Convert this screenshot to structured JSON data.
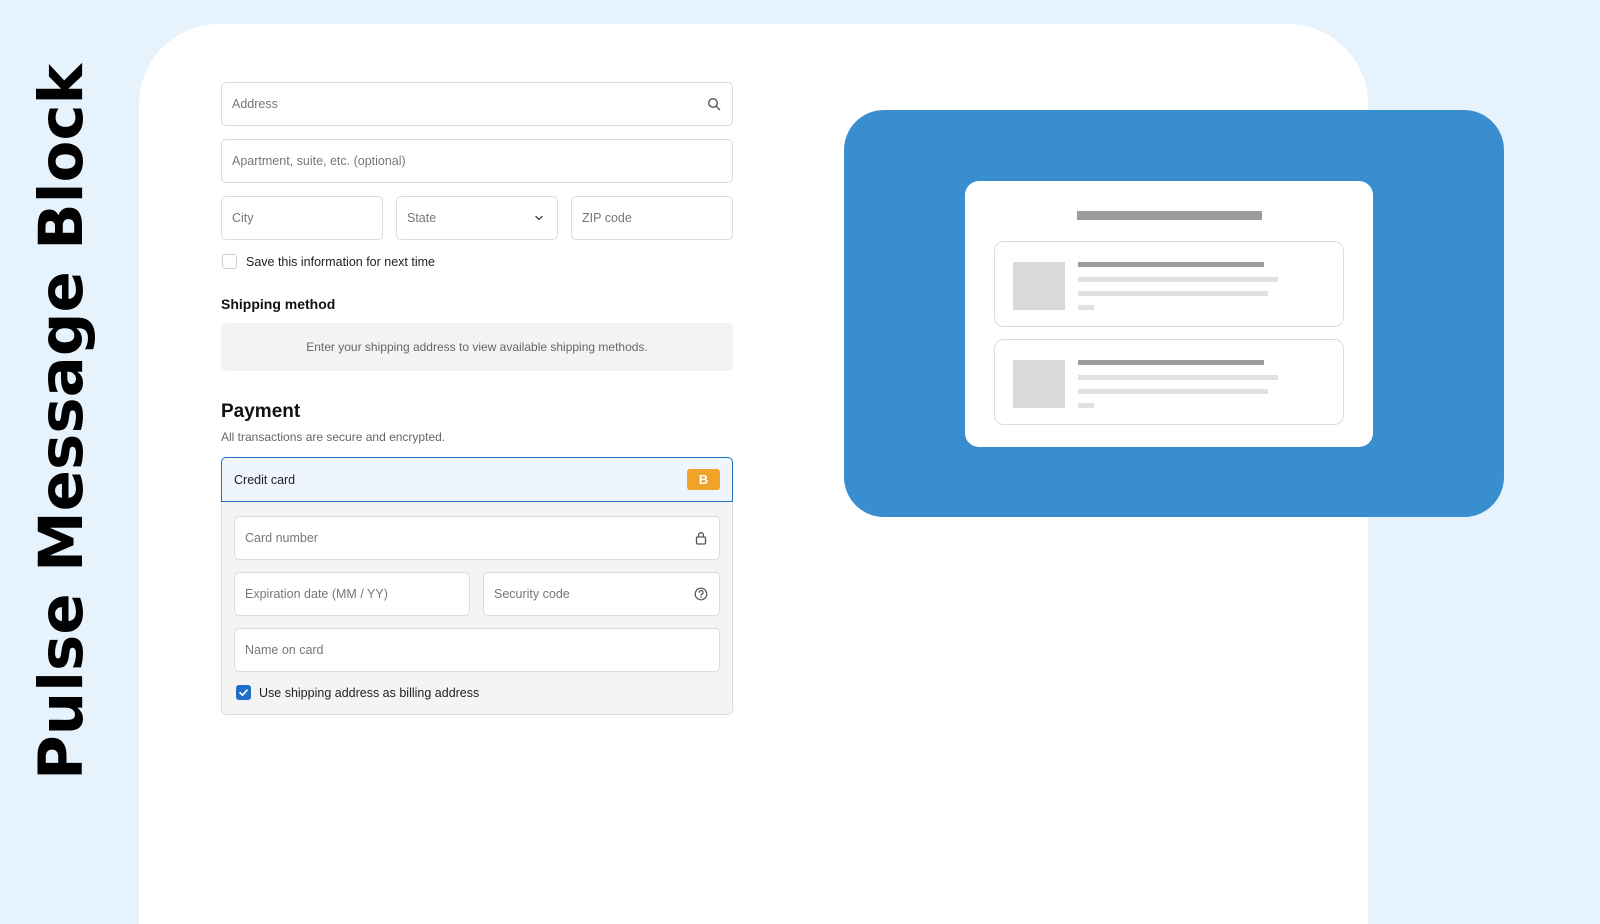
{
  "sidebar": {
    "title": "Pulse Message Block"
  },
  "address": {
    "address_placeholder": "Address",
    "apartment_placeholder": "Apartment, suite, etc. (optional)",
    "city_placeholder": "City",
    "state_label": "State",
    "zip_placeholder": "ZIP code",
    "save_label": "Save this information for next time",
    "save_checked": false
  },
  "shipping": {
    "title": "Shipping method",
    "notice": "Enter your shipping address to view available shipping methods."
  },
  "payment": {
    "title": "Payment",
    "subtitle": "All transactions are secure and encrypted.",
    "method_label": "Credit card",
    "badge": "B",
    "card_number_placeholder": "Card number",
    "expiration_placeholder": "Expiration date (MM / YY)",
    "security_placeholder": "Security code",
    "name_placeholder": "Name on card",
    "billing_label": "Use shipping address as billing address",
    "billing_checked": true
  },
  "colors": {
    "accent": "#1f6fc6",
    "badge": "#f0a229",
    "illustration_bg": "#388ecf",
    "page_bg": "#e6f2fc"
  },
  "icons": {
    "address": "search-icon",
    "state": "chevron-down-icon",
    "card_number": "lock-icon",
    "security": "help-circle-icon",
    "billing_check": "check-icon"
  }
}
